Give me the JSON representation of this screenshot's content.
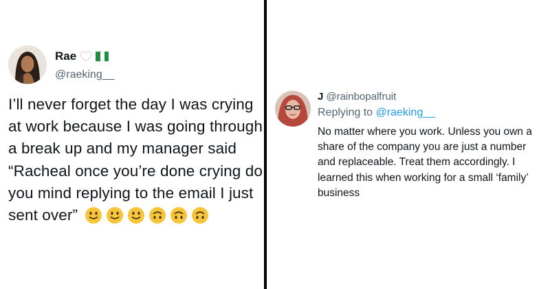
{
  "left_tweet": {
    "name": "Rae",
    "handle": "@raeking__",
    "text": "I’ll never forget the day I was crying at work because I was going through a break up and my manager said “Racheal once you’re done crying do you mind replying to the email I just sent over”",
    "emojis": [
      "slightly-smiling-face",
      "slightly-smiling-face",
      "slightly-smiling-face",
      "upside-down-face",
      "upside-down-face",
      "upside-down-face"
    ],
    "name_icons": [
      "white-heart-icon",
      "nigeria-flag-icon"
    ]
  },
  "right_tweet": {
    "name": "J",
    "handle": "@rainbopalfruit",
    "replying_to_label": "Replying to",
    "replying_to_handle": "@raeking__",
    "text": "No matter where you work. Unless you own a share of the company you are just a number and replaceable. Treat them accordingly. I learned this when working for a small ‘family’ business"
  },
  "colors": {
    "text": "#0f1419",
    "secondary": "#536471",
    "link": "#1d9bf0",
    "divider": "#000000",
    "emoji_yellow": "#f7c53a"
  }
}
